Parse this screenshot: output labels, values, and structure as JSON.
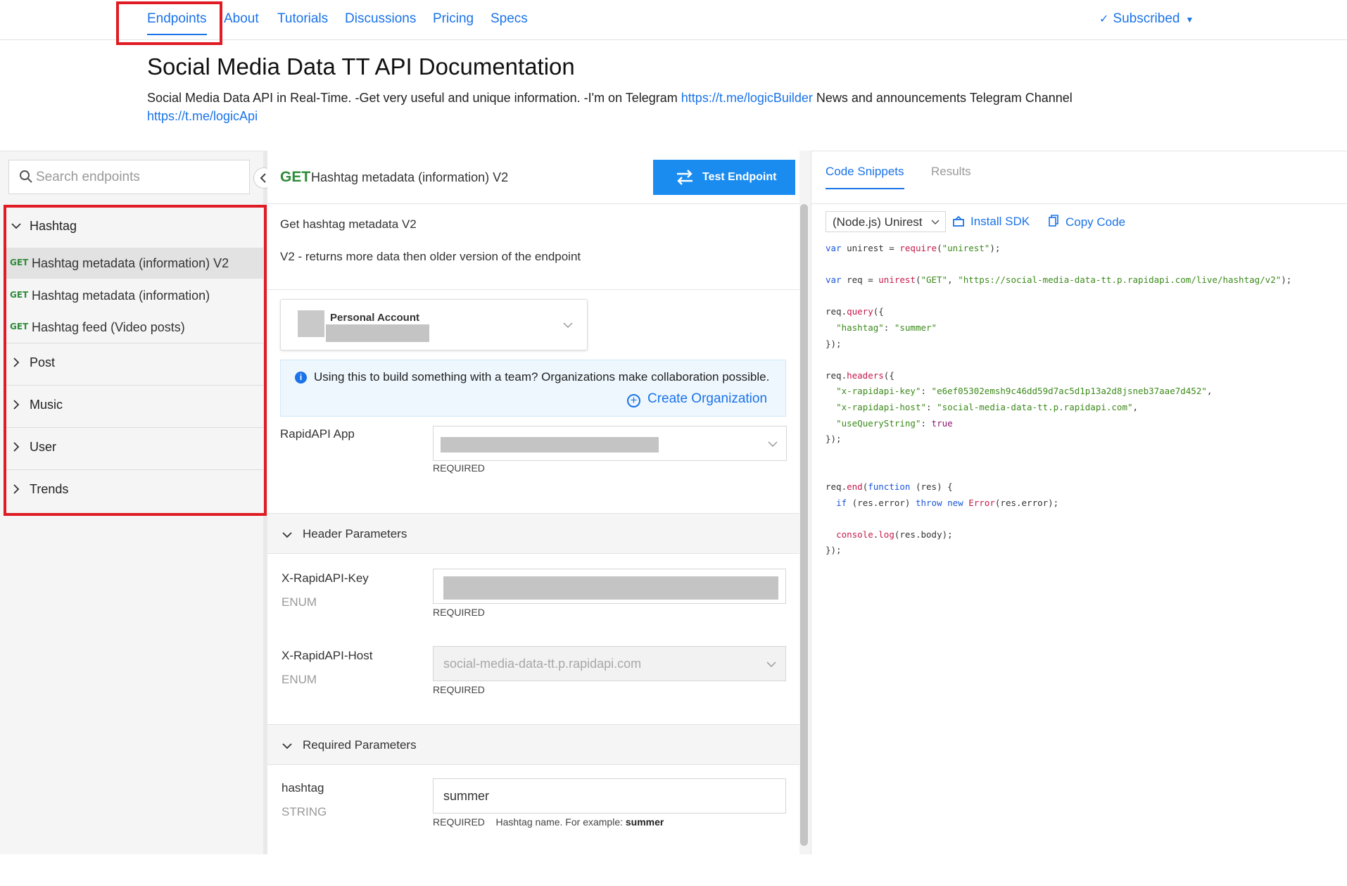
{
  "nav": {
    "tabs": [
      "Endpoints",
      "About",
      "Tutorials",
      "Discussions",
      "Pricing",
      "Specs"
    ],
    "subscribed": "Subscribed"
  },
  "header": {
    "title": "Social Media Data TT API Documentation",
    "description_text": "Social Media Data API in Real-Time. -Get very useful and unique information. -I'm on Telegram ",
    "link1": "https://t.me/logicBuilder",
    "description_text2": " News and announcements Telegram Channel ",
    "link2": "https://t.me/logicApi"
  },
  "sidebar": {
    "search_placeholder": "Search endpoints",
    "groups": [
      {
        "label": "Hashtag",
        "expanded": true,
        "endpoints": [
          {
            "method": "GET",
            "name": "Hashtag metadata (information) V2",
            "selected": true
          },
          {
            "method": "GET",
            "name": "Hashtag metadata (information)",
            "selected": false
          },
          {
            "method": "GET",
            "name": "Hashtag feed (Video posts)",
            "selected": false
          }
        ]
      },
      {
        "label": "Post",
        "expanded": false
      },
      {
        "label": "Music",
        "expanded": false
      },
      {
        "label": "User",
        "expanded": false
      },
      {
        "label": "Trends",
        "expanded": false
      }
    ]
  },
  "endpoint": {
    "method": "GET",
    "title": "Hashtag metadata (information) V2",
    "test_button": "Test Endpoint",
    "desc1": "Get hashtag metadata V2",
    "desc2": "V2 - returns more data then older version of the endpoint",
    "account_label": "Personal Account",
    "org_message": "Using this to build something with a team? Organizations make collaboration possible.",
    "create_org": "Create Organization",
    "rapidapi_app_label": "RapidAPI App",
    "required": "REQUIRED",
    "header_params_label": "Header Parameters",
    "key_label": "X-RapidAPI-Key",
    "key_type": "ENUM",
    "host_label": "X-RapidAPI-Host",
    "host_type": "ENUM",
    "host_value": "social-media-data-tt.p.rapidapi.com",
    "required_params_label": "Required Parameters",
    "param_name": "hashtag",
    "param_type": "STRING",
    "param_value": "summer",
    "param_hint": "Hashtag name. For example: ",
    "param_example": "summer"
  },
  "code_panel": {
    "tabs": [
      "Code Snippets",
      "Results"
    ],
    "language": "(Node.js) Unirest",
    "install_sdk": "Install SDK",
    "copy_code": "Copy Code",
    "lines": [
      "var unirest = require(\"unirest\");",
      "",
      "var req = unirest(\"GET\", \"https://social-media-data-tt.p.rapidapi.com/live/hashtag/v2\");",
      "",
      "req.query({",
      "  \"hashtag\": \"summer\"",
      "});",
      "",
      "req.headers({",
      "  \"x-rapidapi-key\": \"e6ef05302emsh9c46dd59d7ac5d1p13a2d8jsneb37aae7d452\",",
      "  \"x-rapidapi-host\": \"social-media-data-tt.p.rapidapi.com\",",
      "  \"useQueryString\": true",
      "});",
      "",
      "",
      "req.end(function (res) {",
      "  if (res.error) throw new Error(res.error);",
      "",
      "  console.log(res.body);",
      "});"
    ]
  },
  "colors": {
    "accent": "#1a73e8",
    "get_method": "#2e8b3a",
    "annotation_red": "#e01b24",
    "button_blue": "#1a8cf0"
  }
}
